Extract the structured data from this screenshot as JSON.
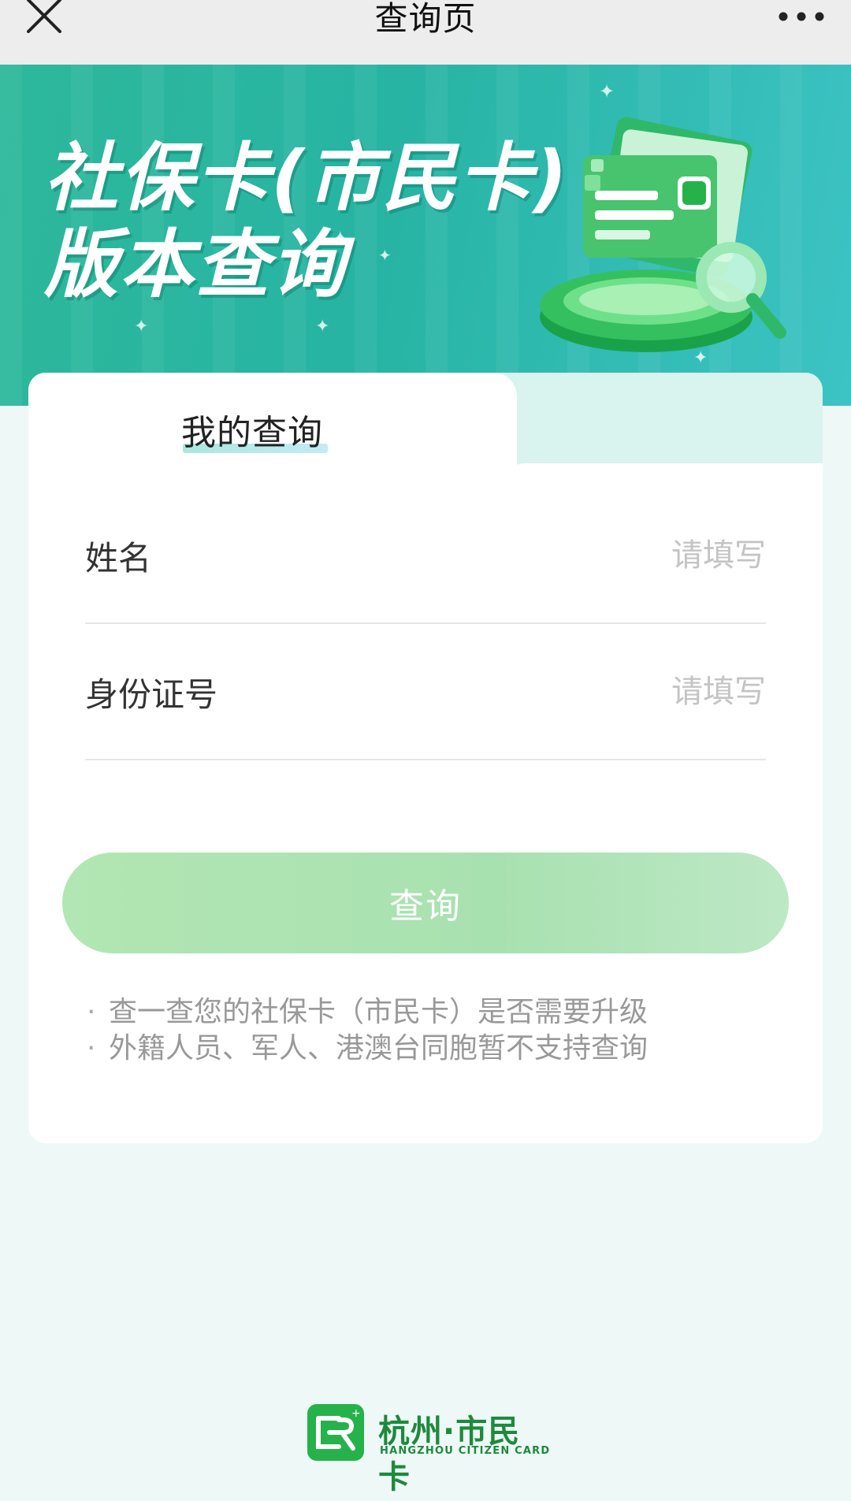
{
  "nav": {
    "title": "查询页",
    "close_icon": "close-icon",
    "more_icon": "more-horizontal-icon"
  },
  "banner": {
    "title_line1": "社保卡(市民卡)",
    "title_line2": "版本查询",
    "illustration": "card-search-illustration"
  },
  "tab": {
    "label": "我的查询"
  },
  "form": {
    "fields": [
      {
        "label": "姓名",
        "placeholder": "请填写",
        "value": ""
      },
      {
        "label": "身份证号",
        "placeholder": "请填写",
        "value": ""
      }
    ],
    "submit_label": "查询"
  },
  "notes": [
    "查一查您的社保卡（市民卡）是否需要升级",
    "外籍人员、军人、港澳台同胞暂不支持查询"
  ],
  "notes_bullet": "·",
  "footer": {
    "brand": "杭州·市民卡",
    "brand_en": "HANGZHOU CITIZEN CARD"
  },
  "colors": {
    "banner": "#2db89b",
    "button": "#b2e6b3",
    "brand_green": "#25b24a",
    "page_bg": "#eef8f6"
  }
}
